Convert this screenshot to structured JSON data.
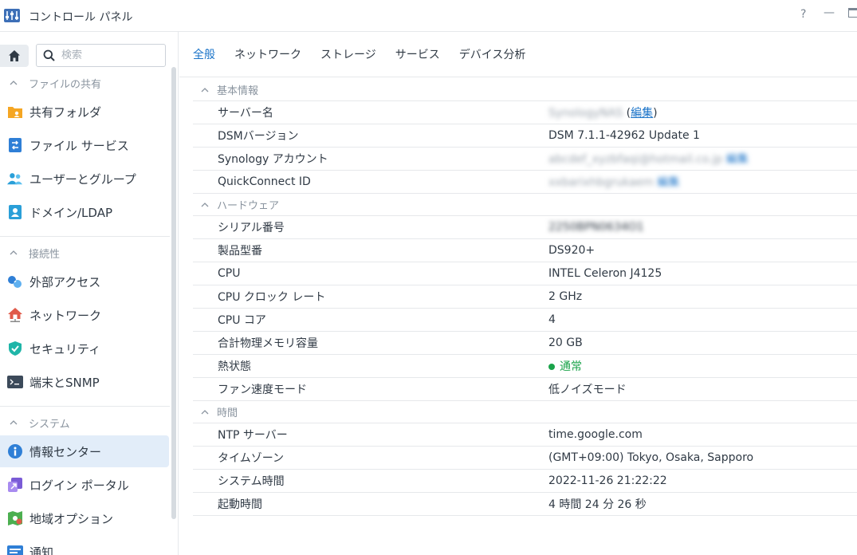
{
  "window": {
    "title": "コントロール パネル",
    "help_glyph": "?",
    "minimize_glyph": "—"
  },
  "sidebar": {
    "search_placeholder": "検索",
    "sections": [
      {
        "label": "ファイルの共有"
      },
      {
        "label": "接続性"
      },
      {
        "label": "システム"
      }
    ],
    "items": [
      {
        "label": "共有フォルダ",
        "icon": "shared-folder-icon"
      },
      {
        "label": "ファイル サービス",
        "icon": "file-services-icon"
      },
      {
        "label": "ユーザーとグループ",
        "icon": "users-groups-icon"
      },
      {
        "label": "ドメイン/LDAP",
        "icon": "domain-ldap-icon"
      },
      {
        "label": "外部アクセス",
        "icon": "external-access-icon"
      },
      {
        "label": "ネットワーク",
        "icon": "network-icon"
      },
      {
        "label": "セキュリティ",
        "icon": "security-shield-icon"
      },
      {
        "label": "端末とSNMP",
        "icon": "terminal-icon"
      },
      {
        "label": "情報センター",
        "icon": "info-center-icon",
        "active": true
      },
      {
        "label": "ログイン ポータル",
        "icon": "login-portal-icon"
      },
      {
        "label": "地域オプション",
        "icon": "regional-options-icon"
      },
      {
        "label": "通知",
        "icon": "notification-icon"
      }
    ]
  },
  "tabs": [
    {
      "label": "全般",
      "active": true
    },
    {
      "label": "ネットワーク"
    },
    {
      "label": "ストレージ"
    },
    {
      "label": "サービス"
    },
    {
      "label": "デバイス分析"
    }
  ],
  "groups": {
    "basic": {
      "label": "基本情報",
      "server_name": {
        "key": "サーバー名",
        "value": "SynologyNAS",
        "edit": "編集"
      },
      "dsm": {
        "key": "DSMバージョン",
        "value": "DSM 7.1.1-42962 Update 1"
      },
      "account": {
        "key": "Synology アカウント",
        "value": "abcdef_xyzbfaqi@hotmail.co.jp",
        "edit": "編集"
      },
      "qc": {
        "key": "QuickConnect ID",
        "value": "xxbarixhbgrukaem",
        "edit": "編集"
      }
    },
    "hardware": {
      "label": "ハードウェア",
      "serial": {
        "key": "シリアル番号",
        "value": "2250BPN0634O1"
      },
      "model": {
        "key": "製品型番",
        "value": "DS920+"
      },
      "cpu": {
        "key": "CPU",
        "value": "INTEL Celeron J4125"
      },
      "clock": {
        "key": "CPU クロック レート",
        "value": "2 GHz"
      },
      "cores": {
        "key": "CPU コア",
        "value": "4"
      },
      "memory": {
        "key": "合計物理メモリ容量",
        "value": "20 GB"
      },
      "thermal": {
        "key": "熱状態",
        "value": "通常",
        "status_color": "#1aa34a"
      },
      "fan": {
        "key": "ファン速度モード",
        "value": "低ノイズモード"
      }
    },
    "time": {
      "label": "時間",
      "ntp": {
        "key": "NTP サーバー",
        "value": "time.google.com"
      },
      "tz": {
        "key": "タイムゾーン",
        "value": "(GMT+09:00) Tokyo, Osaka, Sapporo"
      },
      "systime": {
        "key": "システム時間",
        "value": "2022-11-26 21:22:22"
      },
      "uptime": {
        "key": "起動時間",
        "value": "4 時間 24 分 26 秒"
      }
    }
  },
  "colors": {
    "accent": "#1a73c8",
    "active_bg": "#e2edf9",
    "status_ok": "#1aa34a"
  }
}
